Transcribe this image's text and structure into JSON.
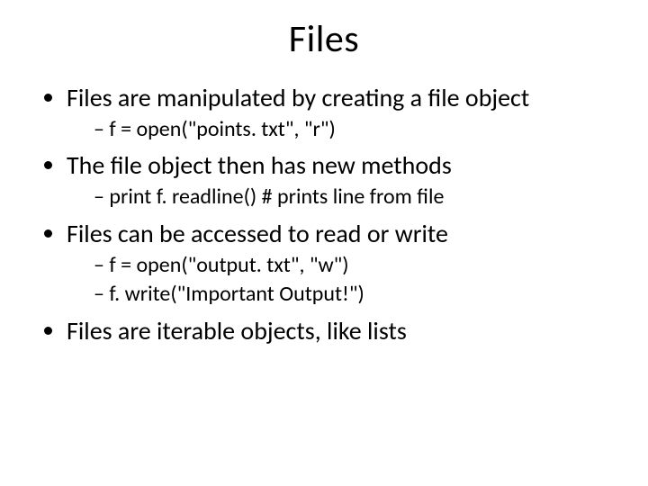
{
  "title": "Files",
  "bullets": [
    {
      "text": "Files are manipulated by creating a file object",
      "sub": [
        "f = open(\"points. txt\", \"r\")"
      ]
    },
    {
      "text": "The file object then has new methods",
      "sub": [
        "print f. readline() # prints line from file"
      ]
    },
    {
      "text": "Files can be accessed to read or write",
      "sub": [
        "f = open(\"output. txt\", \"w\")",
        "f. write(\"Important Output!\")"
      ]
    },
    {
      "text": "Files are iterable objects, like lists",
      "sub": []
    }
  ]
}
